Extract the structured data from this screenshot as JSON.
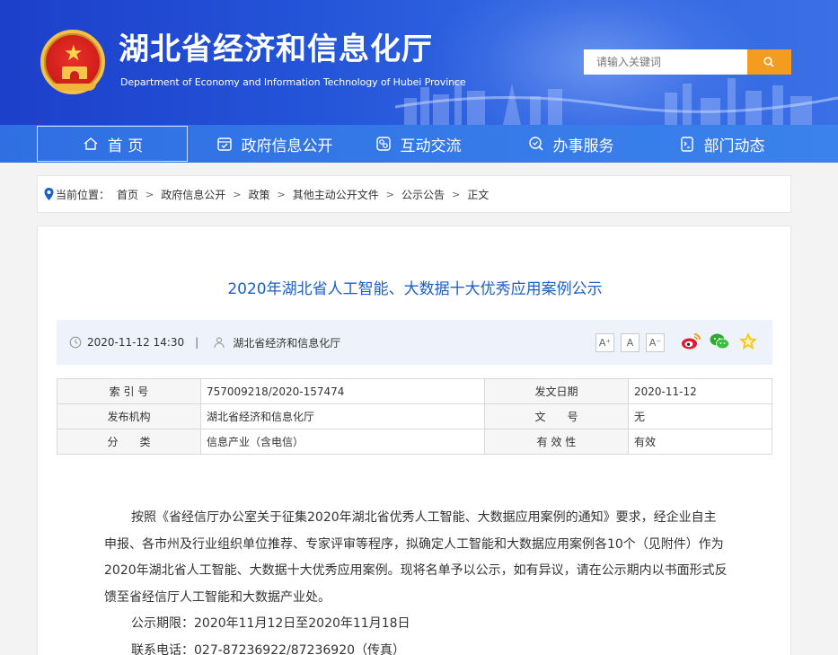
{
  "header": {
    "site_title": "湖北省经济和信息化厅",
    "site_subtitle": "Department of Economy and Information Technology of Hubei Province",
    "search_placeholder": "请输入关键词"
  },
  "nav": {
    "items": [
      {
        "label": "首 页",
        "icon": "home-icon",
        "active": true
      },
      {
        "label": "政府信息公开",
        "icon": "document-check-icon"
      },
      {
        "label": "互动交流",
        "icon": "chat-icon"
      },
      {
        "label": "办事服务",
        "icon": "search-service-icon"
      },
      {
        "label": "部门动态",
        "icon": "news-icon"
      }
    ]
  },
  "breadcrumb": {
    "prefix": "当前位置：",
    "items": [
      "首页",
      "政府信息公开",
      "政策",
      "其他主动公开文件",
      "公示公告",
      "正文"
    ],
    "separator": ">"
  },
  "article": {
    "title": "2020年湖北省人工智能、大数据十大优秀应用案例公示",
    "datetime": "2020-11-12 14:30",
    "meta_separator": "|",
    "source": "湖北省经济和信息化厅",
    "font_sizes": [
      "A⁺",
      "A",
      "A⁻"
    ],
    "share_icons": [
      "weibo-icon",
      "wechat-icon",
      "favorite-star-icon"
    ]
  },
  "info_table": {
    "rows": [
      [
        {
          "key": "索 引 号",
          "value": "757009218/2020-157474"
        },
        {
          "key": "发文日期",
          "value": "2020-11-12"
        }
      ],
      [
        {
          "key": "发布机构",
          "value": "湖北省经济和信息化厅"
        },
        {
          "key": "文　　号",
          "value": "无"
        }
      ],
      [
        {
          "key": "分　　类",
          "value": "信息产业（含电信）"
        },
        {
          "key": "有 效 性",
          "value": "有效"
        }
      ]
    ]
  },
  "body": {
    "paragraph1": "按照《省经信厅办公室关于征集2020年湖北省优秀人工智能、大数据应用案例的通知》要求，经企业自主申报、各市州及行业组织单位推荐、专家评审等程序，拟确定人工智能和大数据应用案例各10个（见附件）作为2020年湖北省人工智能、大数据十大优秀应用案例。现将名单予以公示，如有异议，请在公示期内以书面形式反馈至省经信厅人工智能和大数据产业处。",
    "period": "公示期限：2020年11月12日至2020年11月18日",
    "phone": "联系电话：027-87236922/87236920（传真）"
  },
  "colors": {
    "header_blue": "#2353d8",
    "nav_blue": "#3b82ec",
    "search_orange": "#f39c1f",
    "title_blue": "#1c5fc7"
  }
}
